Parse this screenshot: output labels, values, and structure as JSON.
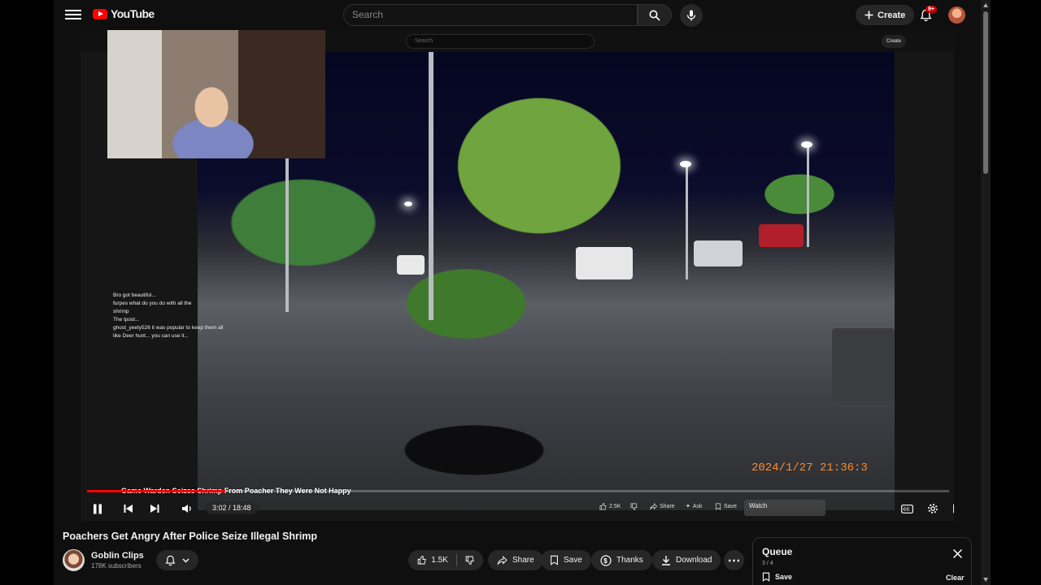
{
  "header": {
    "logo_text": "YouTube",
    "search_placeholder": "Search",
    "create_label": "Create",
    "notification_count": "9+"
  },
  "player": {
    "inner_search_placeholder": "Search",
    "inner_create_label": "Create",
    "overlay_title": "Game Warden Seizes Shrimp From Poacher They Were Not Happy",
    "time_text": "3:02 / 18:48",
    "progress_fraction": 0.16,
    "timestamp_overlay": "2024/1/27  21:36:3",
    "mini_like": "2.5K",
    "mini_share": "Share",
    "mini_ask": "Ask",
    "mini_save": "Save",
    "watch_tip": "Watch",
    "chat": [
      {
        "name": "",
        "text": "Bro got beautiful...",
        "cls": "n"
      },
      {
        "name": "",
        "text": "furpes   what do you do with all the",
        "cls": "n2"
      },
      {
        "name": "",
        "text": "shrimp",
        "cls": "n"
      },
      {
        "name": "",
        "text": "The Ipost...",
        "cls": "n"
      },
      {
        "name": "",
        "text": "ghost_yeety526 it was popular to keep them all",
        "cls": "n2"
      },
      {
        "name": "",
        "text": "like Deer hunt... you can use it...",
        "cls": "n2"
      }
    ]
  },
  "video": {
    "title": "Poachers Get Angry After Police Seize Illegal Shrimp",
    "channel_name": "Goblin Clips",
    "channel_subs": "178K subscribers",
    "like_count": "1.5K",
    "share_label": "Share",
    "save_label": "Save",
    "thanks_label": "Thanks",
    "download_label": "Download"
  },
  "queue": {
    "title": "Queue",
    "count": "3 / 4",
    "save_label": "Save",
    "clear_label": "Clear"
  }
}
